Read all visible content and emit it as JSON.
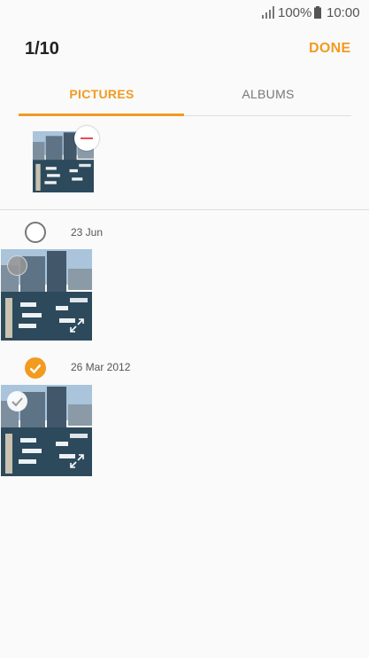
{
  "status_bar": {
    "battery": "100%",
    "time": "10:00"
  },
  "header": {
    "count": "1/10",
    "done_label": "DONE"
  },
  "tabs": [
    {
      "label": "PICTURES",
      "active": true
    },
    {
      "label": "ALBUMS",
      "active": false
    }
  ],
  "groups": [
    {
      "date": "23 Jun",
      "selected": false,
      "photos": [
        {
          "selected": false
        }
      ]
    },
    {
      "date": "26 Mar 2012",
      "selected": true,
      "photos": [
        {
          "selected": true
        }
      ]
    }
  ],
  "colors": {
    "accent": "#f29b21",
    "remove": "#e84c55"
  },
  "icons": [
    "signal-icon",
    "battery-icon",
    "remove-icon",
    "check-icon",
    "expand-icon"
  ]
}
